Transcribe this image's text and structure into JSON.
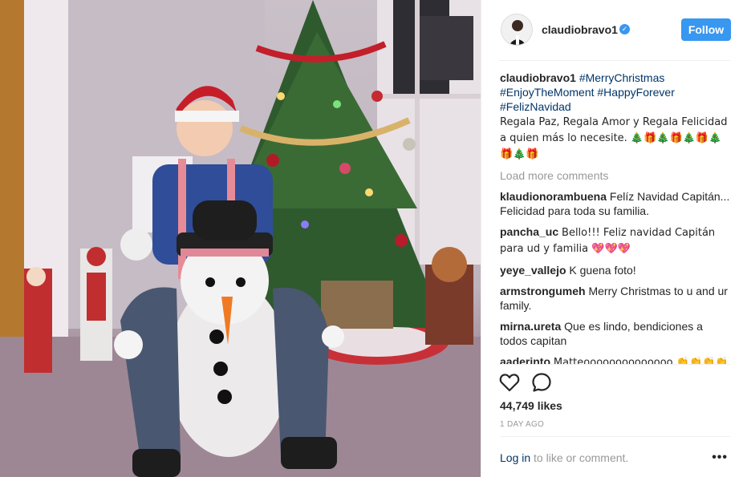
{
  "post": {
    "username": "claudiobravo1",
    "follow_label": "Follow",
    "verified_icon": "verified-check-icon",
    "caption": {
      "username": "claudiobravo1",
      "tags_line1": "#MerryChristmas",
      "tags_line2": "#EnjoyTheMoment #HappyForever",
      "tags_line3": "#FelizNavidad",
      "text": "Regala Paz, Regala Amor y Regala Felicidad a quien más lo necesite. 🎄🎁🎄🎁🎄🎁🎄🎁🎄🎁"
    },
    "load_more": "Load more comments",
    "comments": [
      {
        "username": "klaudionorambuena",
        "text": "Felíz Navidad Capitán... Felicidad para toda su familia."
      },
      {
        "username": "pancha_uc",
        "text": "Bello!!! Feliz navidad Capitán para ud y familia 💖💖💖"
      },
      {
        "username": "yeye_vallejo",
        "text": "K guena foto!"
      },
      {
        "username": "armstrongumeh",
        "text": "Merry Christmas to u and ur family."
      },
      {
        "username": "mirna.ureta",
        "text": "Que es lindo, bendiciones a todos capitan"
      },
      {
        "username": "aaderinto",
        "text": "Matteoooooooooooooo 👏👏👏👏👏👏😊👏"
      }
    ],
    "likes": "44,749 likes",
    "time": "1 DAY AGO",
    "login_link": "Log in",
    "login_rest": " to like or comment.",
    "more_icon": "ellipsis-icon",
    "like_icon": "heart-outline-icon",
    "comment_icon": "comment-bubble-icon",
    "accent_color": "#3897f0"
  }
}
